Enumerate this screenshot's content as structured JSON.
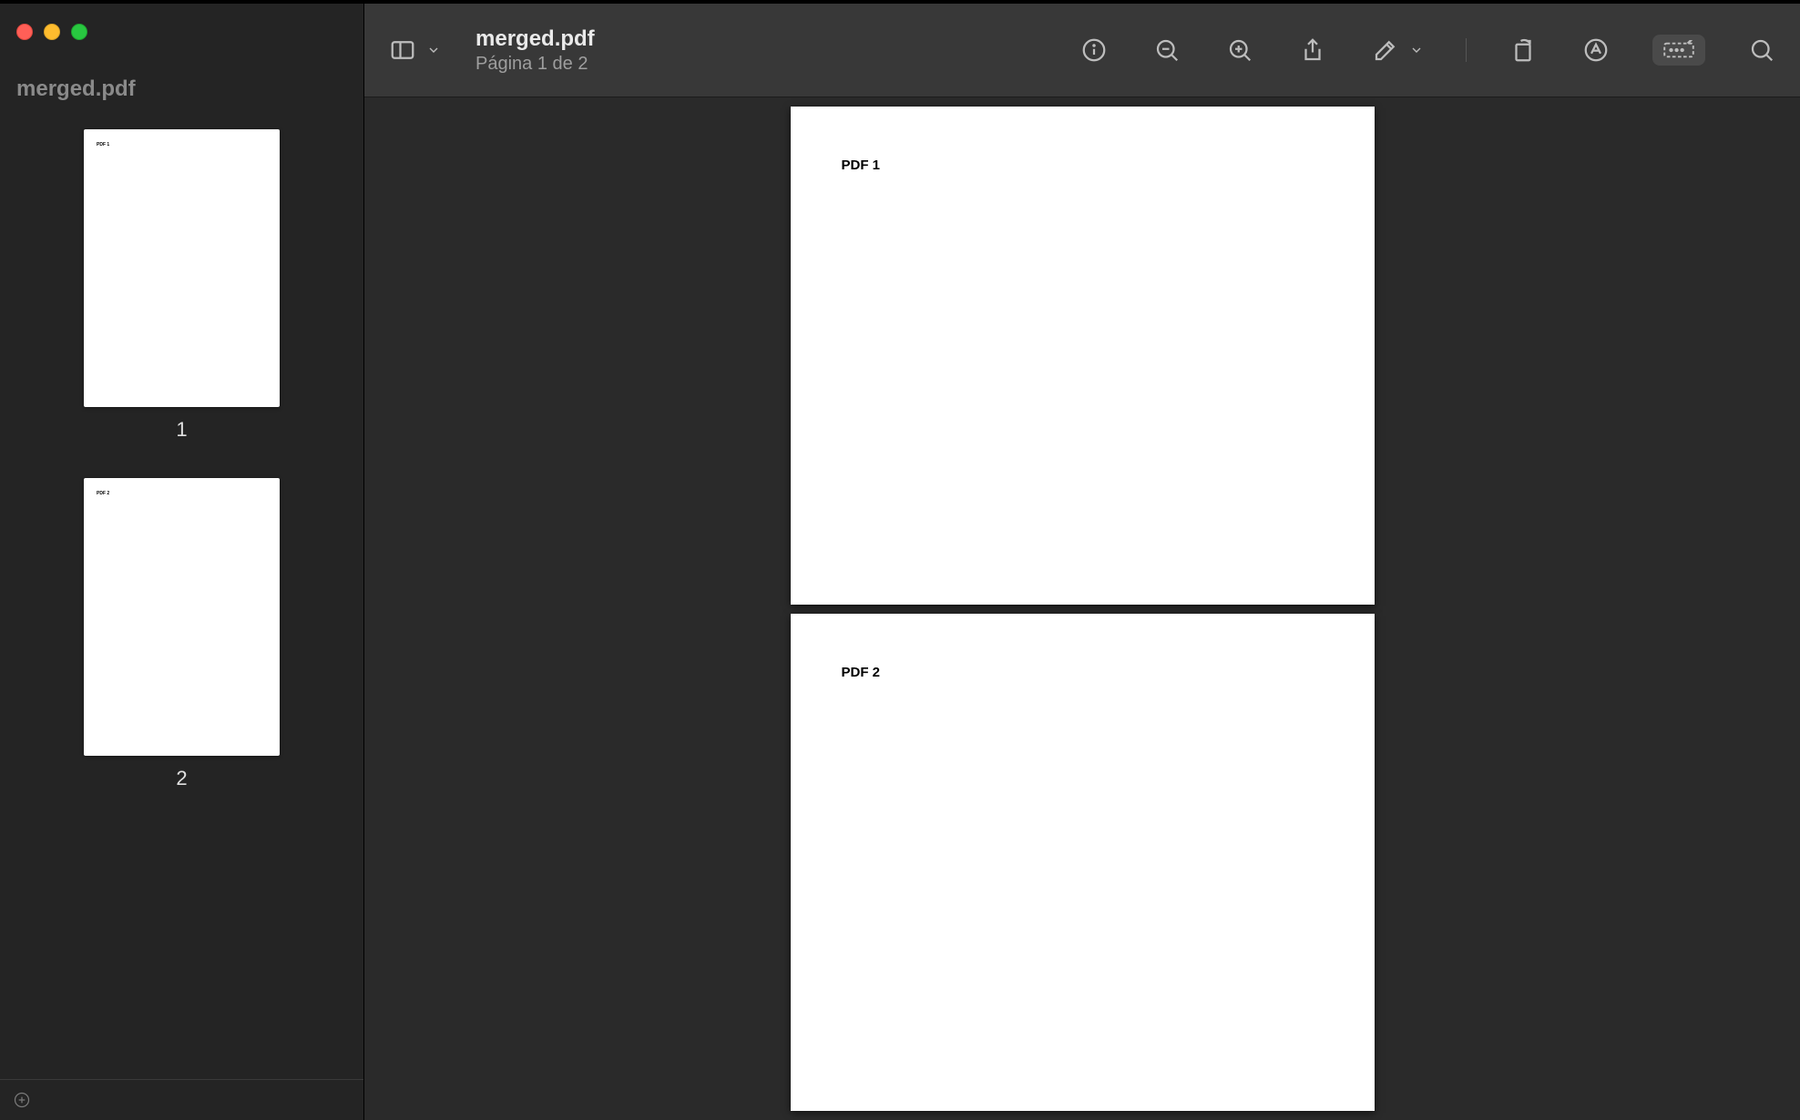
{
  "document": {
    "filename": "merged.pdf",
    "page_status": "Página 1 de 2"
  },
  "sidebar": {
    "title": "merged.pdf",
    "thumbnails": [
      {
        "label": "1",
        "content": "PDF 1"
      },
      {
        "label": "2",
        "content": "PDF 2"
      }
    ]
  },
  "pages": [
    {
      "content": "PDF 1"
    },
    {
      "content": "PDF 2"
    }
  ],
  "toolbar_icons": {
    "sidebar_toggle": "sidebar-icon",
    "view_menu": "chevron-down-icon",
    "info": "info-icon",
    "zoom_out": "zoom-out-icon",
    "zoom_in": "zoom-in-icon",
    "share": "share-icon",
    "highlight": "highlight-icon",
    "highlight_menu": "chevron-down-icon",
    "rotate": "rotate-icon",
    "markup": "markup-icon",
    "form": "form-fill-icon",
    "search": "search-icon"
  }
}
